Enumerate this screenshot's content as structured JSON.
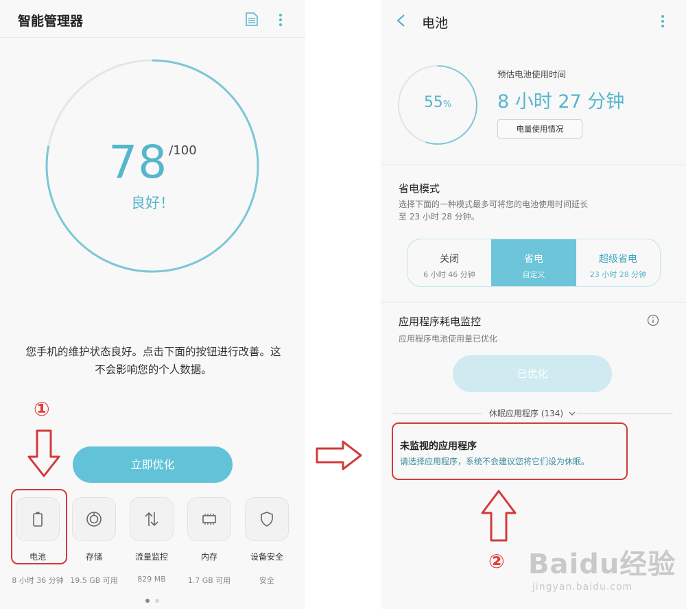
{
  "left": {
    "app_title": "智能管理器",
    "score": {
      "value": "78",
      "max": "/100",
      "status": "良好！",
      "fraction": 0.78
    },
    "description": "您手机的维护状态良好。点击下面的按钮进行改善。这不会影响您的个人数据。",
    "optimize_button": "立即优化",
    "marker": "①",
    "tools": [
      {
        "icon": "battery-icon",
        "label": "电池",
        "sub": "8 小时 36 分钟"
      },
      {
        "icon": "storage-icon",
        "label": "存储",
        "sub": "19.5 GB 可用"
      },
      {
        "icon": "data-traffic-icon",
        "label": "流量监控",
        "sub": "829 MB"
      },
      {
        "icon": "memory-icon",
        "label": "内存",
        "sub": "1.7 GB 可用"
      },
      {
        "icon": "security-shield-icon",
        "label": "设备安全",
        "sub": "安全"
      }
    ]
  },
  "right": {
    "title": "电池",
    "battery_percent": "55",
    "battery_percent_unit": "%",
    "battery_fraction": 0.55,
    "estimate_label": "预估电池使用时间",
    "estimate_value": "8 小时 27 分钟",
    "usage_button": "电量使用情况",
    "power_saving": {
      "title": "省电模式",
      "text_line1": "选择下面的一种模式最多可将您的电池使用时间延长",
      "text_line2": "至 23 小时 28 分钟。",
      "modes": [
        {
          "name": "关闭",
          "sub": "6 小时 46 分钟"
        },
        {
          "name": "省电",
          "sub": "自定义"
        },
        {
          "name": "超级省电",
          "sub": "23 小时 28 分钟"
        }
      ],
      "selected": "省电"
    },
    "monitor": {
      "title": "应用程序耗电监控",
      "text": "应用程序电池使用量已优化",
      "button": "已优化"
    },
    "sleeping_apps": "休眠应用程序 (134)",
    "unmonitored": {
      "title": "未监视的应用程序",
      "text": "请选择应用程序，系统不会建议您将它们设为休眠。"
    },
    "marker": "②"
  },
  "watermark": {
    "brand": "Baidu经验",
    "url": "jingyan.baidu.com"
  },
  "colors": {
    "accent": "#56b6cc",
    "accent_button": "#62c3d8",
    "highlight": "#d23a3a"
  }
}
